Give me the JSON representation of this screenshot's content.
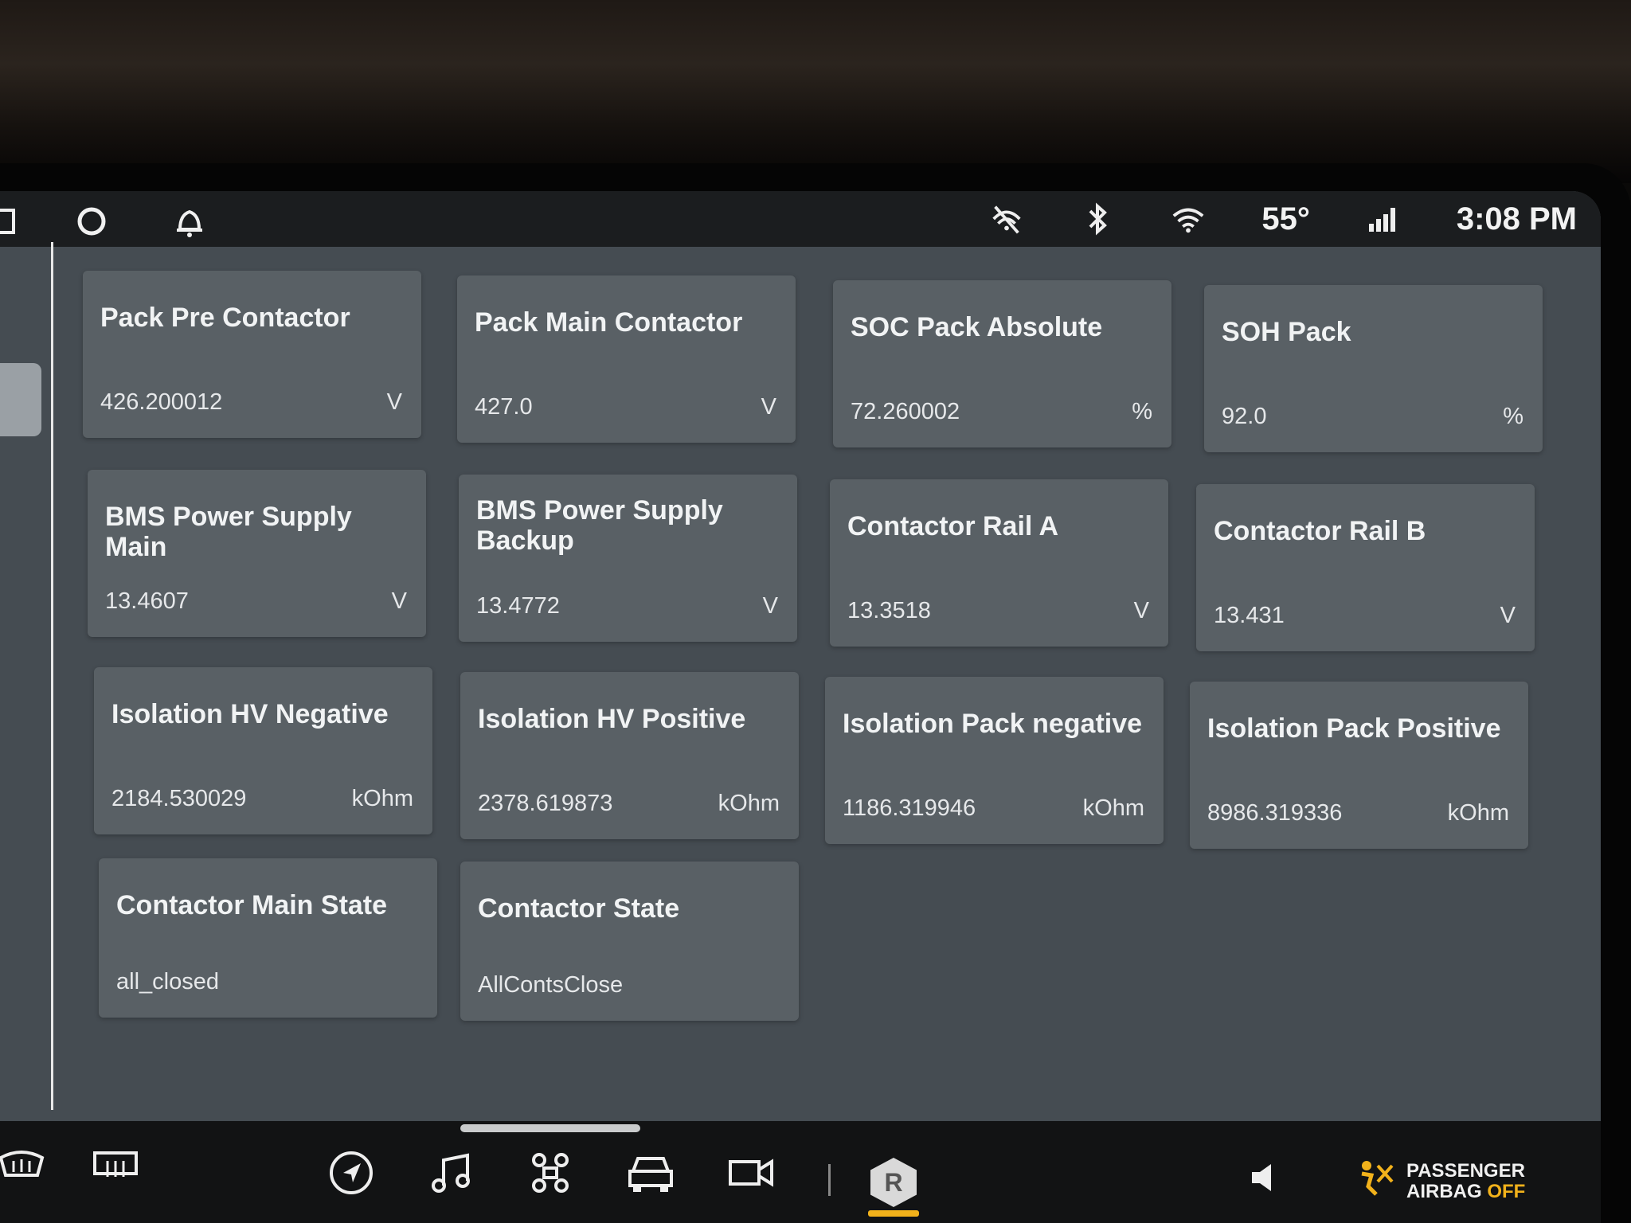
{
  "status_bar": {
    "temperature": "55°",
    "time": "3:08 PM",
    "icons": [
      "display-icon",
      "alexa-ring-icon",
      "bell-icon",
      "no-signal-icon",
      "bluetooth-icon",
      "wifi-icon",
      "lte-signal-icon"
    ]
  },
  "tiles": [
    {
      "title": "Pack Pre Contactor",
      "value": "426.200012",
      "unit": "V"
    },
    {
      "title": "Pack Main Contactor",
      "value": "427.0",
      "unit": "V"
    },
    {
      "title": "SOC Pack Absolute",
      "value": "72.260002",
      "unit": "%"
    },
    {
      "title": "SOH Pack",
      "value": "92.0",
      "unit": "%"
    },
    {
      "title": "BMS Power Supply Main",
      "value": "13.4607",
      "unit": "V"
    },
    {
      "title": "BMS Power Supply Backup",
      "value": "13.4772",
      "unit": "V"
    },
    {
      "title": "Contactor Rail A",
      "value": "13.3518",
      "unit": "V"
    },
    {
      "title": "Contactor Rail B",
      "value": "13.431",
      "unit": "V"
    },
    {
      "title": "Isolation HV Negative",
      "value": "2184.530029",
      "unit": "kOhm"
    },
    {
      "title": "Isolation HV Positive",
      "value": "2378.619873",
      "unit": "kOhm"
    },
    {
      "title": "Isolation Pack negative",
      "value": "1186.319946",
      "unit": "kOhm"
    },
    {
      "title": "Isolation Pack Positive",
      "value": "8986.319336",
      "unit": "kOhm"
    },
    {
      "title": "Contactor Main State",
      "value": "all_closed",
      "unit": ""
    },
    {
      "title": "Contactor State",
      "value": "AllContsClose",
      "unit": ""
    }
  ],
  "bottom_bar": {
    "icons": [
      "rear-defrost-icon",
      "front-defrost-icon",
      "navigation-icon",
      "music-icon",
      "controls-icon",
      "vehicle-icon",
      "camera-icon",
      "rivian-logo-icon",
      "volume-icon",
      "airbag-icon"
    ],
    "logo_letter": "R",
    "airbag_line1": "PASSENGER",
    "airbag_line2_a": "AIRBAG ",
    "airbag_line2_b": "OFF",
    "accent": "#f2b21b"
  }
}
